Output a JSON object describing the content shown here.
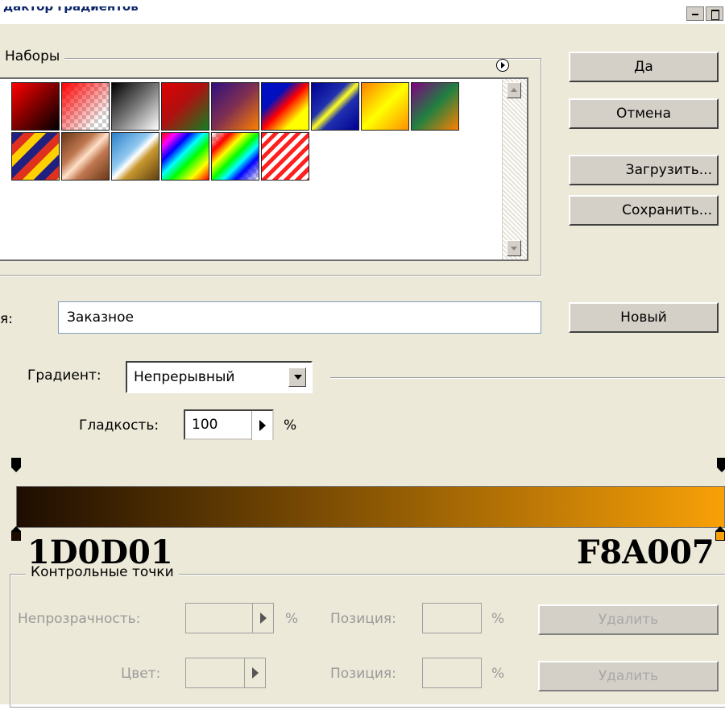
{
  "window": {
    "title": "дактор градиентов"
  },
  "presets": {
    "label": "Наборы",
    "swatches": [
      {
        "name": "red-black"
      },
      {
        "name": "red-transparent"
      },
      {
        "name": "black-white"
      },
      {
        "name": "red-green"
      },
      {
        "name": "violet-orange"
      },
      {
        "name": "blue-red-yellow"
      },
      {
        "name": "blue-yellow-blue"
      },
      {
        "name": "orange-yellow-orange"
      },
      {
        "name": "violet-green-orange"
      },
      {
        "name": "transparent-stripes"
      },
      {
        "name": "copper"
      },
      {
        "name": "chrome"
      },
      {
        "name": "spectrum"
      },
      {
        "name": "transparent-rainbow"
      },
      {
        "name": "transparent-stripes-red"
      }
    ]
  },
  "buttons": {
    "ok": "Да",
    "cancel": "Отмена",
    "load": "Загрузить...",
    "save": "Сохранить...",
    "new": "Новый"
  },
  "name_field": {
    "label": "я:",
    "value": "Заказное"
  },
  "gradient_type": {
    "label": "Градиент:",
    "value": "Непрерывный"
  },
  "smoothness": {
    "label": "Гладкость:",
    "value": "100",
    "unit": "%"
  },
  "gradient": {
    "start_color": "#1d0d01",
    "end_color": "#f8a007",
    "start_label": "1D0D01",
    "end_label": "F8A007"
  },
  "stops": {
    "label": "Контрольные точки",
    "opacity_label": "Непрозрачность:",
    "opacity_unit": "%",
    "position_label": "Позиция:",
    "position_unit": "%",
    "delete_label": "Удалить",
    "color_label": "Цвет:",
    "position2_label": "Позиция:",
    "position2_unit": "%",
    "delete2_label": "Удалить"
  }
}
